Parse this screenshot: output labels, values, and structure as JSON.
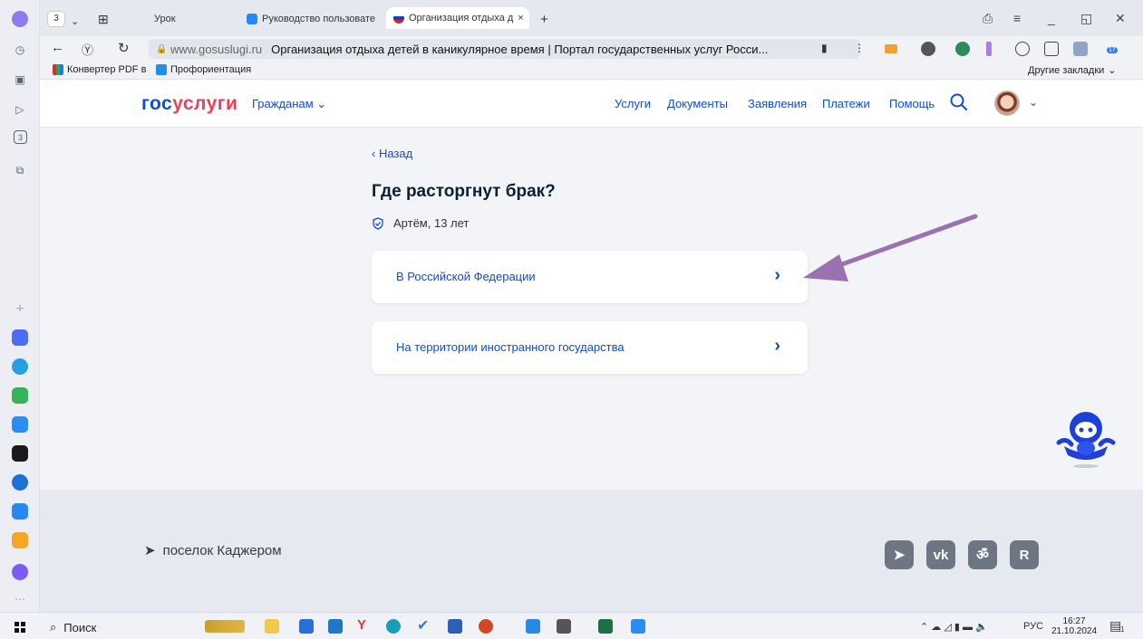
{
  "browser": {
    "tab_count": "3",
    "tabs": [
      {
        "label": "Урок"
      },
      {
        "label": "Руководство пользовате"
      },
      {
        "label": "Организация отдыха д"
      }
    ],
    "url_domain": "www.gosuslugi.ru",
    "url_title": "Организация отдыха детей в каникулярное время | Портал государственных услуг Росси...",
    "bookmarks": [
      {
        "label": "Конвертер PDF в"
      },
      {
        "label": "Профориентация"
      }
    ],
    "other_bookmarks": "Другие закладки",
    "extension_badge": "17"
  },
  "site": {
    "logo_part1": "гос",
    "logo_part2": "услуги",
    "citizens": "Гражданам",
    "nav": [
      "Услуги",
      "Документы",
      "Заявления",
      "Платежи",
      "Помощь"
    ]
  },
  "main": {
    "back": "Назад",
    "title": "Где расторгнут брак?",
    "child": "Артём, 13 лет",
    "options": [
      {
        "label": "В Российской Федерации"
      },
      {
        "label": "На территории иностранного государства"
      }
    ]
  },
  "footer": {
    "location": "поселок Каджером",
    "socials": [
      "telegram-icon",
      "vk-icon",
      "ok-icon",
      "rutube-icon"
    ]
  },
  "taskbar": {
    "search": "Поиск",
    "lang": "РУС",
    "time": "16:27",
    "date": "21.10.2024",
    "notif_count": "1"
  },
  "colors": {
    "brand_blue": "#0d4cd3",
    "brand_red": "#ee3f58",
    "arrow": "#9b72b0"
  }
}
